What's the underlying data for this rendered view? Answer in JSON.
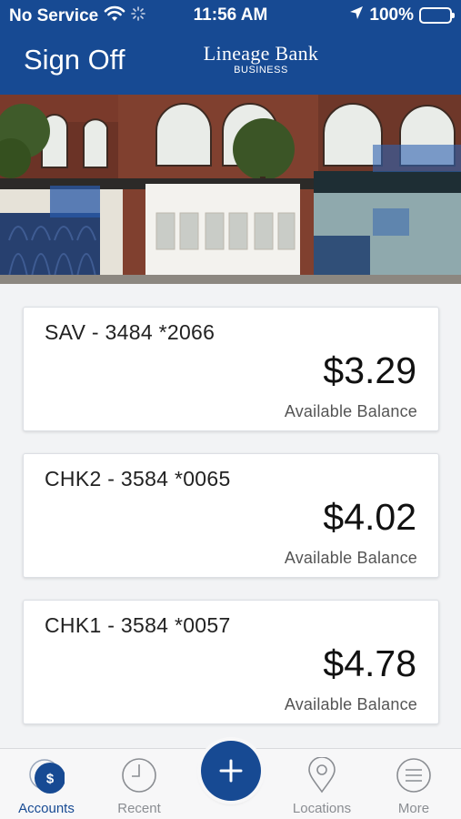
{
  "status_bar": {
    "carrier": "No Service",
    "time": "11:56 AM",
    "battery": "100%"
  },
  "nav": {
    "sign_off": "Sign Off",
    "brand_name": "Lineage Bank",
    "brand_sub": "BUSINESS"
  },
  "accounts": [
    {
      "name": "SAV - 3484 *2066",
      "balance": "$3.29",
      "label": "Available Balance"
    },
    {
      "name": "CHK2 - 3584 *0065",
      "balance": "$4.02",
      "label": "Available Balance"
    },
    {
      "name": "CHK1 - 3584 *0057",
      "balance": "$4.78",
      "label": "Available Balance"
    }
  ],
  "tabs": [
    {
      "label": "Accounts",
      "icon": "accounts-icon",
      "active": true
    },
    {
      "label": "Recent",
      "icon": "clock-icon"
    },
    {
      "label": "Locations",
      "icon": "location-pin-icon"
    },
    {
      "label": "More",
      "icon": "menu-icon"
    }
  ],
  "colors": {
    "primary": "#174a93",
    "background": "#f2f3f5",
    "tab_inactive": "#8a8d92"
  }
}
